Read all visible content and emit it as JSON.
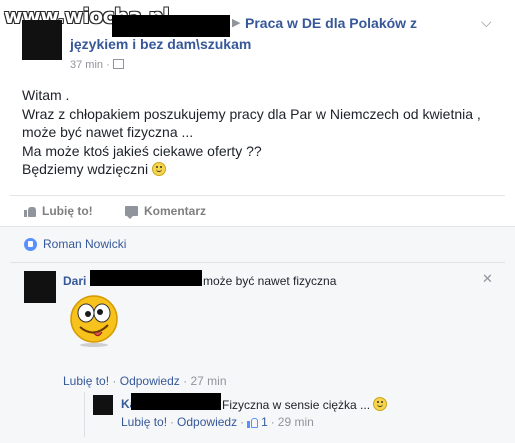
{
  "watermark": "www.wiocha.pl",
  "post": {
    "group_line1": "Praca w DE dla Polaków z",
    "group_line2": "językiem i bez dam\\szukam",
    "time": "37 min",
    "body": [
      "Witam .",
      "Wraz z chłopakiem poszukujemy pracy dla Par w Niemczech od kwietnia ,",
      "może być nawet fizyczna ...",
      "Ma może ktoś jakieś ciekawe oferty ??",
      "Będziemy wdzięczni"
    ]
  },
  "actions": {
    "like": "Lubię to!",
    "comment": "Komentarz"
  },
  "likes": {
    "name": "Roman Nowicki"
  },
  "comment1": {
    "name": "Dari",
    "text": "może być nawet fizyczna",
    "like": "Lubię to!",
    "reply": "Odpowiedz",
    "time": "27 min"
  },
  "comment2": {
    "name": "Kasien",
    "text": "Fizyczna w sensie ciężka ...",
    "like": "Lubię to!",
    "reply": "Odpowiedz",
    "like_count": "1",
    "time": "29 min"
  },
  "icons": {
    "brand_blue": "#365899",
    "like_blue": "#5890ff"
  }
}
